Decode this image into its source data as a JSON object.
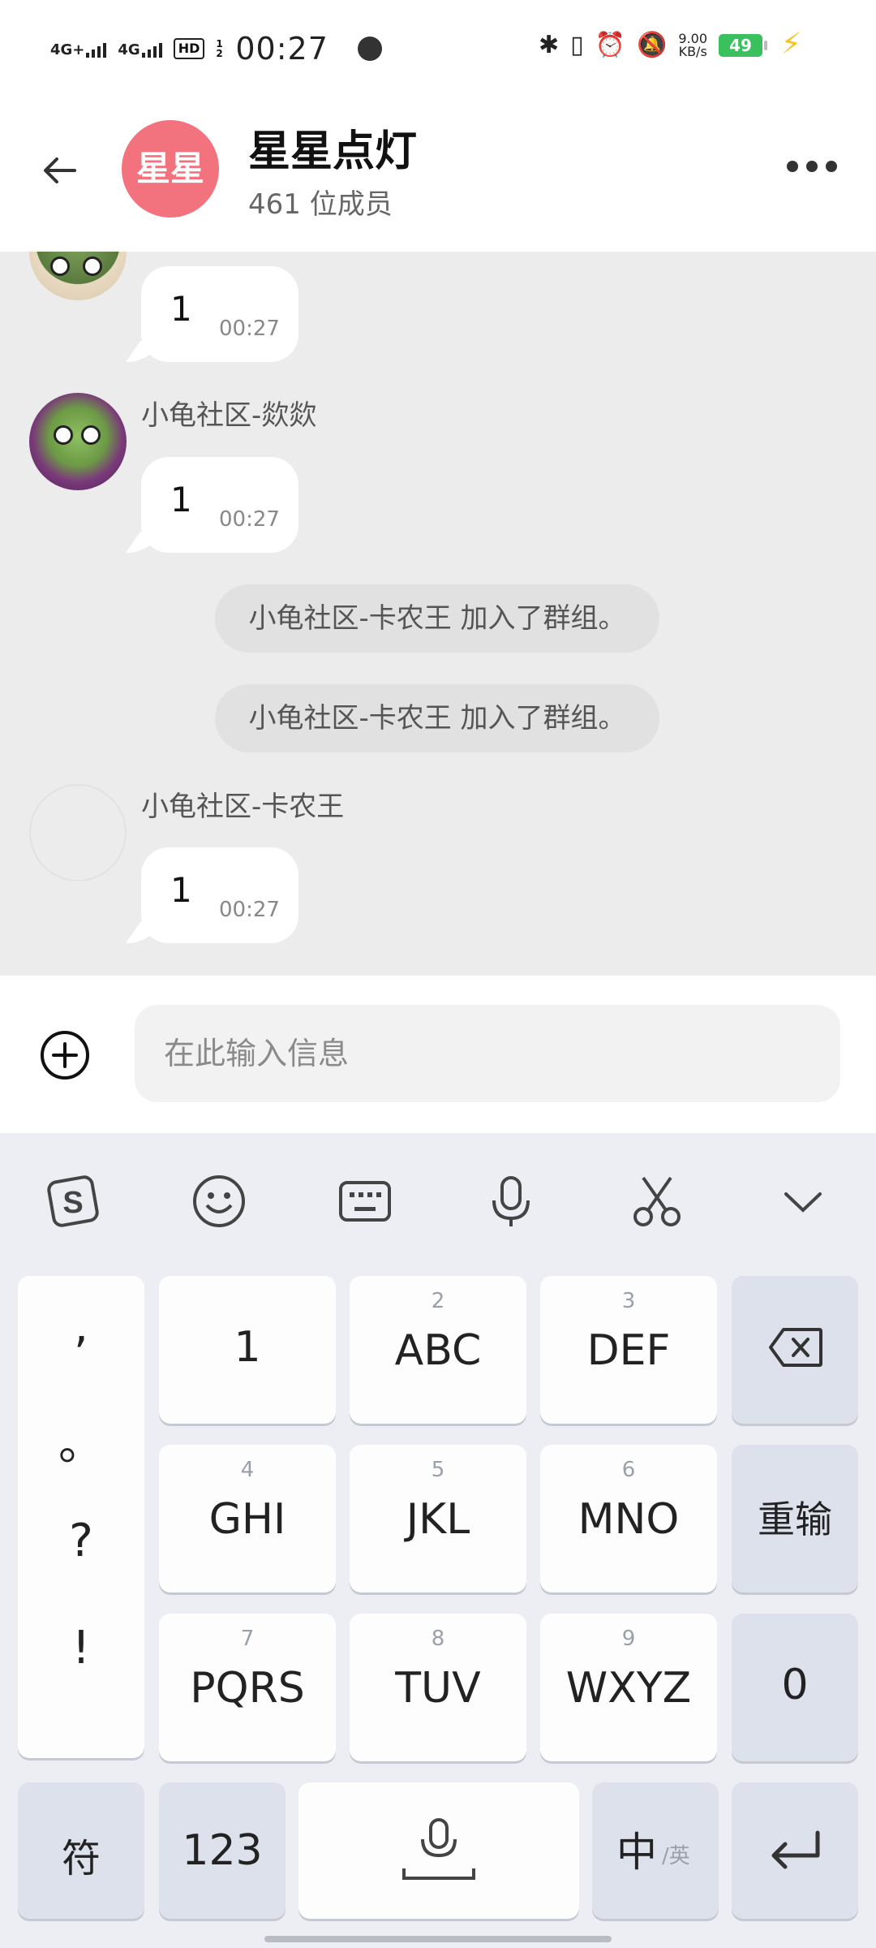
{
  "status_bar": {
    "net1": "4G+",
    "net2": "4G",
    "hd": "HD",
    "hd_sub": "1 2",
    "time": "00:27",
    "speed_value": "9.00",
    "speed_unit": "KB/s",
    "battery": "49"
  },
  "header": {
    "avatar_text": "星星",
    "title": "星星点灯",
    "member_count": "461 位成员"
  },
  "messages": [
    {
      "sender": "",
      "text": "1",
      "time": "00:27"
    },
    {
      "sender": "小龟社区-欻欻",
      "text": "1",
      "time": "00:27"
    },
    {
      "system": "小龟社区-卡农王 加入了群组。"
    },
    {
      "system": "小龟社区-卡农王 加入了群组。"
    },
    {
      "sender": "小龟社区-卡农王",
      "text": "1",
      "time": "00:27"
    }
  ],
  "input": {
    "placeholder": "在此输入信息"
  },
  "keyboard": {
    "toolbar_icons": [
      "sogou-icon",
      "emoji-icon",
      "keyboard-icon",
      "microphone-icon",
      "scissors-icon",
      "chevron-down-icon"
    ],
    "punct": [
      ",",
      "。",
      "?",
      "!"
    ],
    "keys": [
      {
        "sub": "",
        "main": "1"
      },
      {
        "sub": "2",
        "main": "ABC"
      },
      {
        "sub": "3",
        "main": "DEF"
      },
      {
        "sub": "4",
        "main": "GHI"
      },
      {
        "sub": "5",
        "main": "JKL"
      },
      {
        "sub": "6",
        "main": "MNO"
      },
      {
        "sub": "7",
        "main": "PQRS"
      },
      {
        "sub": "8",
        "main": "TUV"
      },
      {
        "sub": "9",
        "main": "WXYZ"
      }
    ],
    "reinput": "重输",
    "zero": "0",
    "symbols": "符",
    "numbers": "123",
    "lang_main": "中",
    "lang_sub": "/英"
  },
  "colors": {
    "group_avatar": "#f2727e",
    "chat_bg": "#ececec",
    "battery": "#3ac15d",
    "keyboard_bg": "#eceef4"
  }
}
